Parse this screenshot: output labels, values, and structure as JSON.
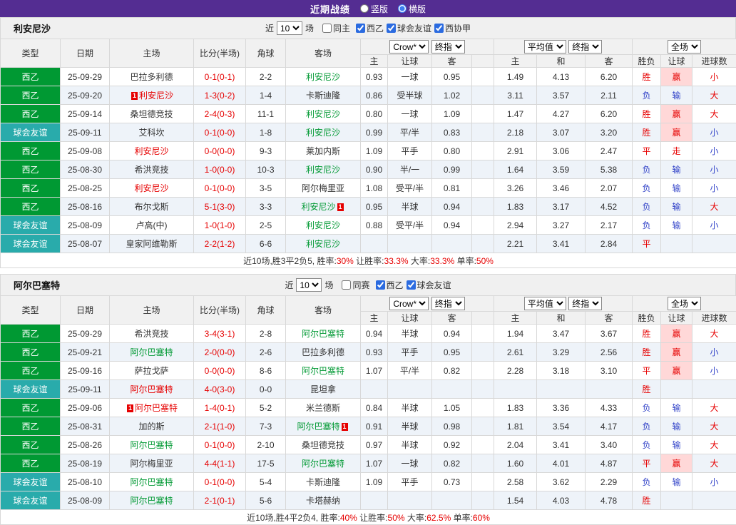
{
  "topbar": {
    "title": "近期战绩",
    "options": [
      {
        "label": "竖版",
        "selected": false
      },
      {
        "label": "横版",
        "selected": true
      }
    ]
  },
  "colors": {
    "accent_purple": "#542d92",
    "league_green": "#009933",
    "friendly_teal": "#29abab",
    "win_red": "#e60000",
    "loss_blue": "#3142c8",
    "highlight_pink": "#ffd8d8"
  },
  "selects": {
    "bookmaker": "Crow*",
    "final": "终指",
    "average": "平均值",
    "scope": "全场"
  },
  "headers": {
    "type": "类型",
    "date": "日期",
    "home": "主场",
    "score": "比分(半场)",
    "corners": "角球",
    "away": "客场",
    "odds_home": "主",
    "odds_handicap": "让球",
    "odds_away": "客",
    "avg_home": "主",
    "avg_draw": "和",
    "avg_away": "客",
    "result": "胜负",
    "handicap_result": "让球",
    "goals": "进球数"
  },
  "sections": [
    {
      "team": "利安尼沙",
      "filters": {
        "prefix": "近",
        "count": "10",
        "suffix": "场",
        "same_label": "同主",
        "same_checked": false,
        "leagues": [
          {
            "label": "西乙",
            "checked": true
          },
          {
            "label": "球会友谊",
            "checked": true
          },
          {
            "label": "西协甲",
            "checked": true
          }
        ]
      },
      "rows": [
        {
          "type": "西乙",
          "tc": "green",
          "date": "25-09-29",
          "home": {
            "n": "巴拉多利德",
            "c": "black"
          },
          "score": "0-1(0-1)",
          "corners": "2-2",
          "away": {
            "n": "利安尼沙",
            "c": "green"
          },
          "o1": "0.93",
          "o2": "一球",
          "o3": "0.95",
          "a1": "1.49",
          "a2": "4.13",
          "a3": "6.20",
          "r": {
            "t": "胜",
            "c": "red"
          },
          "h": {
            "t": "赢",
            "c": "red",
            "hl": true
          },
          "g": {
            "t": "小",
            "c": "red"
          }
        },
        {
          "type": "西乙",
          "tc": "green",
          "date": "25-09-20",
          "home": {
            "n": "利安尼沙",
            "c": "red",
            "badge": "before"
          },
          "score": "1-3(0-2)",
          "corners": "1-4",
          "away": {
            "n": "卡斯迪隆",
            "c": "black"
          },
          "o1": "0.86",
          "o2": "受半球",
          "o3": "1.02",
          "a1": "3.11",
          "a2": "3.57",
          "a3": "2.11",
          "r": {
            "t": "负",
            "c": "blue"
          },
          "h": {
            "t": "输",
            "c": "blue"
          },
          "g": {
            "t": "大",
            "c": "red"
          }
        },
        {
          "type": "西乙",
          "tc": "green",
          "date": "25-09-14",
          "home": {
            "n": "桑坦德竞技",
            "c": "black"
          },
          "score": "2-4(0-3)",
          "corners": "11-1",
          "away": {
            "n": "利安尼沙",
            "c": "green"
          },
          "o1": "0.80",
          "o2": "一球",
          "o3": "1.09",
          "a1": "1.47",
          "a2": "4.27",
          "a3": "6.20",
          "r": {
            "t": "胜",
            "c": "red"
          },
          "h": {
            "t": "赢",
            "c": "red",
            "hl": true
          },
          "g": {
            "t": "大",
            "c": "red"
          }
        },
        {
          "type": "球会友谊",
          "tc": "teal",
          "date": "25-09-11",
          "home": {
            "n": "艾科坎",
            "c": "black"
          },
          "score": "0-1(0-0)",
          "corners": "1-8",
          "away": {
            "n": "利安尼沙",
            "c": "green"
          },
          "o1": "0.99",
          "o2": "平/半",
          "o3": "0.83",
          "a1": "2.18",
          "a2": "3.07",
          "a3": "3.20",
          "r": {
            "t": "胜",
            "c": "red"
          },
          "h": {
            "t": "赢",
            "c": "red",
            "hl": true
          },
          "g": {
            "t": "小",
            "c": "blue"
          }
        },
        {
          "type": "西乙",
          "tc": "green",
          "date": "25-09-08",
          "home": {
            "n": "利安尼沙",
            "c": "red"
          },
          "score": "0-0(0-0)",
          "corners": "9-3",
          "away": {
            "n": "莱加内斯",
            "c": "black"
          },
          "o1": "1.09",
          "o2": "平手",
          "o3": "0.80",
          "a1": "2.91",
          "a2": "3.06",
          "a3": "2.47",
          "r": {
            "t": "平",
            "c": "red"
          },
          "h": {
            "t": "走",
            "c": "red"
          },
          "g": {
            "t": "小",
            "c": "blue"
          }
        },
        {
          "type": "西乙",
          "tc": "green",
          "date": "25-08-30",
          "home": {
            "n": "希洪竞技",
            "c": "black"
          },
          "score": "1-0(0-0)",
          "corners": "10-3",
          "away": {
            "n": "利安尼沙",
            "c": "green"
          },
          "o1": "0.90",
          "o2": "半/一",
          "o3": "0.99",
          "a1": "1.64",
          "a2": "3.59",
          "a3": "5.38",
          "r": {
            "t": "负",
            "c": "blue"
          },
          "h": {
            "t": "输",
            "c": "blue"
          },
          "g": {
            "t": "小",
            "c": "blue"
          }
        },
        {
          "type": "西乙",
          "tc": "green",
          "date": "25-08-25",
          "home": {
            "n": "利安尼沙",
            "c": "red"
          },
          "score": "0-1(0-0)",
          "corners": "3-5",
          "away": {
            "n": "阿尔梅里亚",
            "c": "black"
          },
          "o1": "1.08",
          "o2": "受平/半",
          "o3": "0.81",
          "a1": "3.26",
          "a2": "3.46",
          "a3": "2.07",
          "r": {
            "t": "负",
            "c": "blue"
          },
          "h": {
            "t": "输",
            "c": "blue"
          },
          "g": {
            "t": "小",
            "c": "blue"
          }
        },
        {
          "type": "西乙",
          "tc": "green",
          "date": "25-08-16",
          "home": {
            "n": "布尔戈斯",
            "c": "black"
          },
          "score": "5-1(3-0)",
          "corners": "3-3",
          "away": {
            "n": "利安尼沙",
            "c": "green",
            "badge": "after"
          },
          "o1": "0.95",
          "o2": "半球",
          "o3": "0.94",
          "a1": "1.83",
          "a2": "3.17",
          "a3": "4.52",
          "r": {
            "t": "负",
            "c": "blue"
          },
          "h": {
            "t": "输",
            "c": "blue"
          },
          "g": {
            "t": "大",
            "c": "red"
          }
        },
        {
          "type": "球会友谊",
          "tc": "teal",
          "date": "25-08-09",
          "home": {
            "n": "卢高(中)",
            "c": "black"
          },
          "score": "1-0(1-0)",
          "corners": "2-5",
          "away": {
            "n": "利安尼沙",
            "c": "green"
          },
          "o1": "0.88",
          "o2": "受平/半",
          "o3": "0.94",
          "a1": "2.94",
          "a2": "3.27",
          "a3": "2.17",
          "r": {
            "t": "负",
            "c": "blue"
          },
          "h": {
            "t": "输",
            "c": "blue"
          },
          "g": {
            "t": "小",
            "c": "blue"
          }
        },
        {
          "type": "球会友谊",
          "tc": "teal",
          "date": "25-08-07",
          "home": {
            "n": "皇家阿维勒斯",
            "c": "black"
          },
          "score": "2-2(1-2)",
          "corners": "6-6",
          "away": {
            "n": "利安尼沙",
            "c": "green"
          },
          "o1": "",
          "o2": "",
          "o3": "",
          "a1": "2.21",
          "a2": "3.41",
          "a3": "2.84",
          "r": {
            "t": "平",
            "c": "red"
          },
          "h": null,
          "g": null
        }
      ],
      "summary": [
        {
          "text": "近10场,胜3平2负5, 胜率:",
          "color": "black"
        },
        {
          "text": "30%",
          "color": "red"
        },
        {
          "text": " 让胜率:",
          "color": "black"
        },
        {
          "text": "33.3%",
          "color": "red"
        },
        {
          "text": " 大率:",
          "color": "black"
        },
        {
          "text": "33.3%",
          "color": "red"
        },
        {
          "text": " 单率:",
          "color": "black"
        },
        {
          "text": "50%",
          "color": "red"
        }
      ]
    },
    {
      "team": "阿尔巴塞特",
      "filters": {
        "prefix": "近",
        "count": "10",
        "suffix": "场",
        "same_label": "同赛",
        "same_checked": false,
        "leagues": [
          {
            "label": "西乙",
            "checked": true
          },
          {
            "label": "球会友谊",
            "checked": true
          }
        ]
      },
      "rows": [
        {
          "type": "西乙",
          "tc": "green",
          "date": "25-09-29",
          "home": {
            "n": "希洪竞技",
            "c": "black"
          },
          "score": "3-4(3-1)",
          "corners": "2-8",
          "away": {
            "n": "阿尔巴塞特",
            "c": "green"
          },
          "o1": "0.94",
          "o2": "半球",
          "o3": "0.94",
          "a1": "1.94",
          "a2": "3.47",
          "a3": "3.67",
          "r": {
            "t": "胜",
            "c": "red"
          },
          "h": {
            "t": "赢",
            "c": "red",
            "hl": true
          },
          "g": {
            "t": "大",
            "c": "red"
          }
        },
        {
          "type": "西乙",
          "tc": "green",
          "date": "25-09-21",
          "home": {
            "n": "阿尔巴塞特",
            "c": "green"
          },
          "score": "2-0(0-0)",
          "corners": "2-6",
          "away": {
            "n": "巴拉多利德",
            "c": "black"
          },
          "o1": "0.93",
          "o2": "平手",
          "o3": "0.95",
          "a1": "2.61",
          "a2": "3.29",
          "a3": "2.56",
          "r": {
            "t": "胜",
            "c": "red"
          },
          "h": {
            "t": "赢",
            "c": "red",
            "hl": true
          },
          "g": {
            "t": "小",
            "c": "blue"
          }
        },
        {
          "type": "西乙",
          "tc": "green",
          "date": "25-09-16",
          "home": {
            "n": "萨拉戈萨",
            "c": "black"
          },
          "score": "0-0(0-0)",
          "corners": "8-6",
          "away": {
            "n": "阿尔巴塞特",
            "c": "green"
          },
          "o1": "1.07",
          "o2": "平/半",
          "o3": "0.82",
          "a1": "2.28",
          "a2": "3.18",
          "a3": "3.10",
          "r": {
            "t": "平",
            "c": "red"
          },
          "h": {
            "t": "赢",
            "c": "red",
            "hl": true
          },
          "g": {
            "t": "小",
            "c": "blue"
          }
        },
        {
          "type": "球会友谊",
          "tc": "teal",
          "date": "25-09-11",
          "home": {
            "n": "阿尔巴塞特",
            "c": "red"
          },
          "score": "4-0(3-0)",
          "corners": "0-0",
          "away": {
            "n": "昆坦拿",
            "c": "black"
          },
          "o1": "",
          "o2": "",
          "o3": "",
          "a1": "",
          "a2": "",
          "a3": "",
          "r": {
            "t": "胜",
            "c": "red"
          },
          "h": null,
          "g": null
        },
        {
          "type": "西乙",
          "tc": "green",
          "date": "25-09-06",
          "home": {
            "n": "阿尔巴塞特",
            "c": "red",
            "badge": "before"
          },
          "score": "1-4(0-1)",
          "corners": "5-2",
          "away": {
            "n": "米兰德斯",
            "c": "black"
          },
          "o1": "0.84",
          "o2": "半球",
          "o3": "1.05",
          "a1": "1.83",
          "a2": "3.36",
          "a3": "4.33",
          "r": {
            "t": "负",
            "c": "blue"
          },
          "h": {
            "t": "输",
            "c": "blue"
          },
          "g": {
            "t": "大",
            "c": "red"
          }
        },
        {
          "type": "西乙",
          "tc": "green",
          "date": "25-08-31",
          "home": {
            "n": "加的斯",
            "c": "black"
          },
          "score": "2-1(1-0)",
          "corners": "7-3",
          "away": {
            "n": "阿尔巴塞特",
            "c": "green",
            "badge": "after"
          },
          "o1": "0.91",
          "o2": "半球",
          "o3": "0.98",
          "a1": "1.81",
          "a2": "3.54",
          "a3": "4.17",
          "r": {
            "t": "负",
            "c": "blue"
          },
          "h": {
            "t": "输",
            "c": "blue"
          },
          "g": {
            "t": "大",
            "c": "red"
          }
        },
        {
          "type": "西乙",
          "tc": "green",
          "date": "25-08-26",
          "home": {
            "n": "阿尔巴塞特",
            "c": "green"
          },
          "score": "0-1(0-0)",
          "corners": "2-10",
          "away": {
            "n": "桑坦德竞技",
            "c": "black"
          },
          "o1": "0.97",
          "o2": "半球",
          "o3": "0.92",
          "a1": "2.04",
          "a2": "3.41",
          "a3": "3.40",
          "r": {
            "t": "负",
            "c": "blue"
          },
          "h": {
            "t": "输",
            "c": "blue"
          },
          "g": {
            "t": "大",
            "c": "red"
          }
        },
        {
          "type": "西乙",
          "tc": "green",
          "date": "25-08-19",
          "home": {
            "n": "阿尔梅里亚",
            "c": "black"
          },
          "score": "4-4(1-1)",
          "corners": "17-5",
          "away": {
            "n": "阿尔巴塞特",
            "c": "green"
          },
          "o1": "1.07",
          "o2": "一球",
          "o3": "0.82",
          "a1": "1.60",
          "a2": "4.01",
          "a3": "4.87",
          "r": {
            "t": "平",
            "c": "red"
          },
          "h": {
            "t": "赢",
            "c": "red",
            "hl": true
          },
          "g": {
            "t": "大",
            "c": "red"
          }
        },
        {
          "type": "球会友谊",
          "tc": "teal",
          "date": "25-08-10",
          "home": {
            "n": "阿尔巴塞特",
            "c": "green"
          },
          "score": "0-1(0-0)",
          "corners": "5-4",
          "away": {
            "n": "卡斯迪隆",
            "c": "black"
          },
          "o1": "1.09",
          "o2": "平手",
          "o3": "0.73",
          "a1": "2.58",
          "a2": "3.62",
          "a3": "2.29",
          "r": {
            "t": "负",
            "c": "blue"
          },
          "h": {
            "t": "输",
            "c": "blue"
          },
          "g": {
            "t": "小",
            "c": "blue"
          }
        },
        {
          "type": "球会友谊",
          "tc": "teal",
          "date": "25-08-09",
          "home": {
            "n": "阿尔巴塞特",
            "c": "green"
          },
          "score": "2-1(0-1)",
          "corners": "5-6",
          "away": {
            "n": "卡塔赫纳",
            "c": "black"
          },
          "o1": "",
          "o2": "",
          "o3": "",
          "a1": "1.54",
          "a2": "4.03",
          "a3": "4.78",
          "r": {
            "t": "胜",
            "c": "red"
          },
          "h": null,
          "g": null
        }
      ],
      "summary": [
        {
          "text": "近10场,胜4平2负4, 胜率:",
          "color": "black"
        },
        {
          "text": "40%",
          "color": "red"
        },
        {
          "text": " 让胜率:",
          "color": "black"
        },
        {
          "text": "50%",
          "color": "red"
        },
        {
          "text": " 大率:",
          "color": "black"
        },
        {
          "text": "62.5%",
          "color": "red"
        },
        {
          "text": " 单率:",
          "color": "black"
        },
        {
          "text": "60%",
          "color": "red"
        }
      ]
    }
  ]
}
